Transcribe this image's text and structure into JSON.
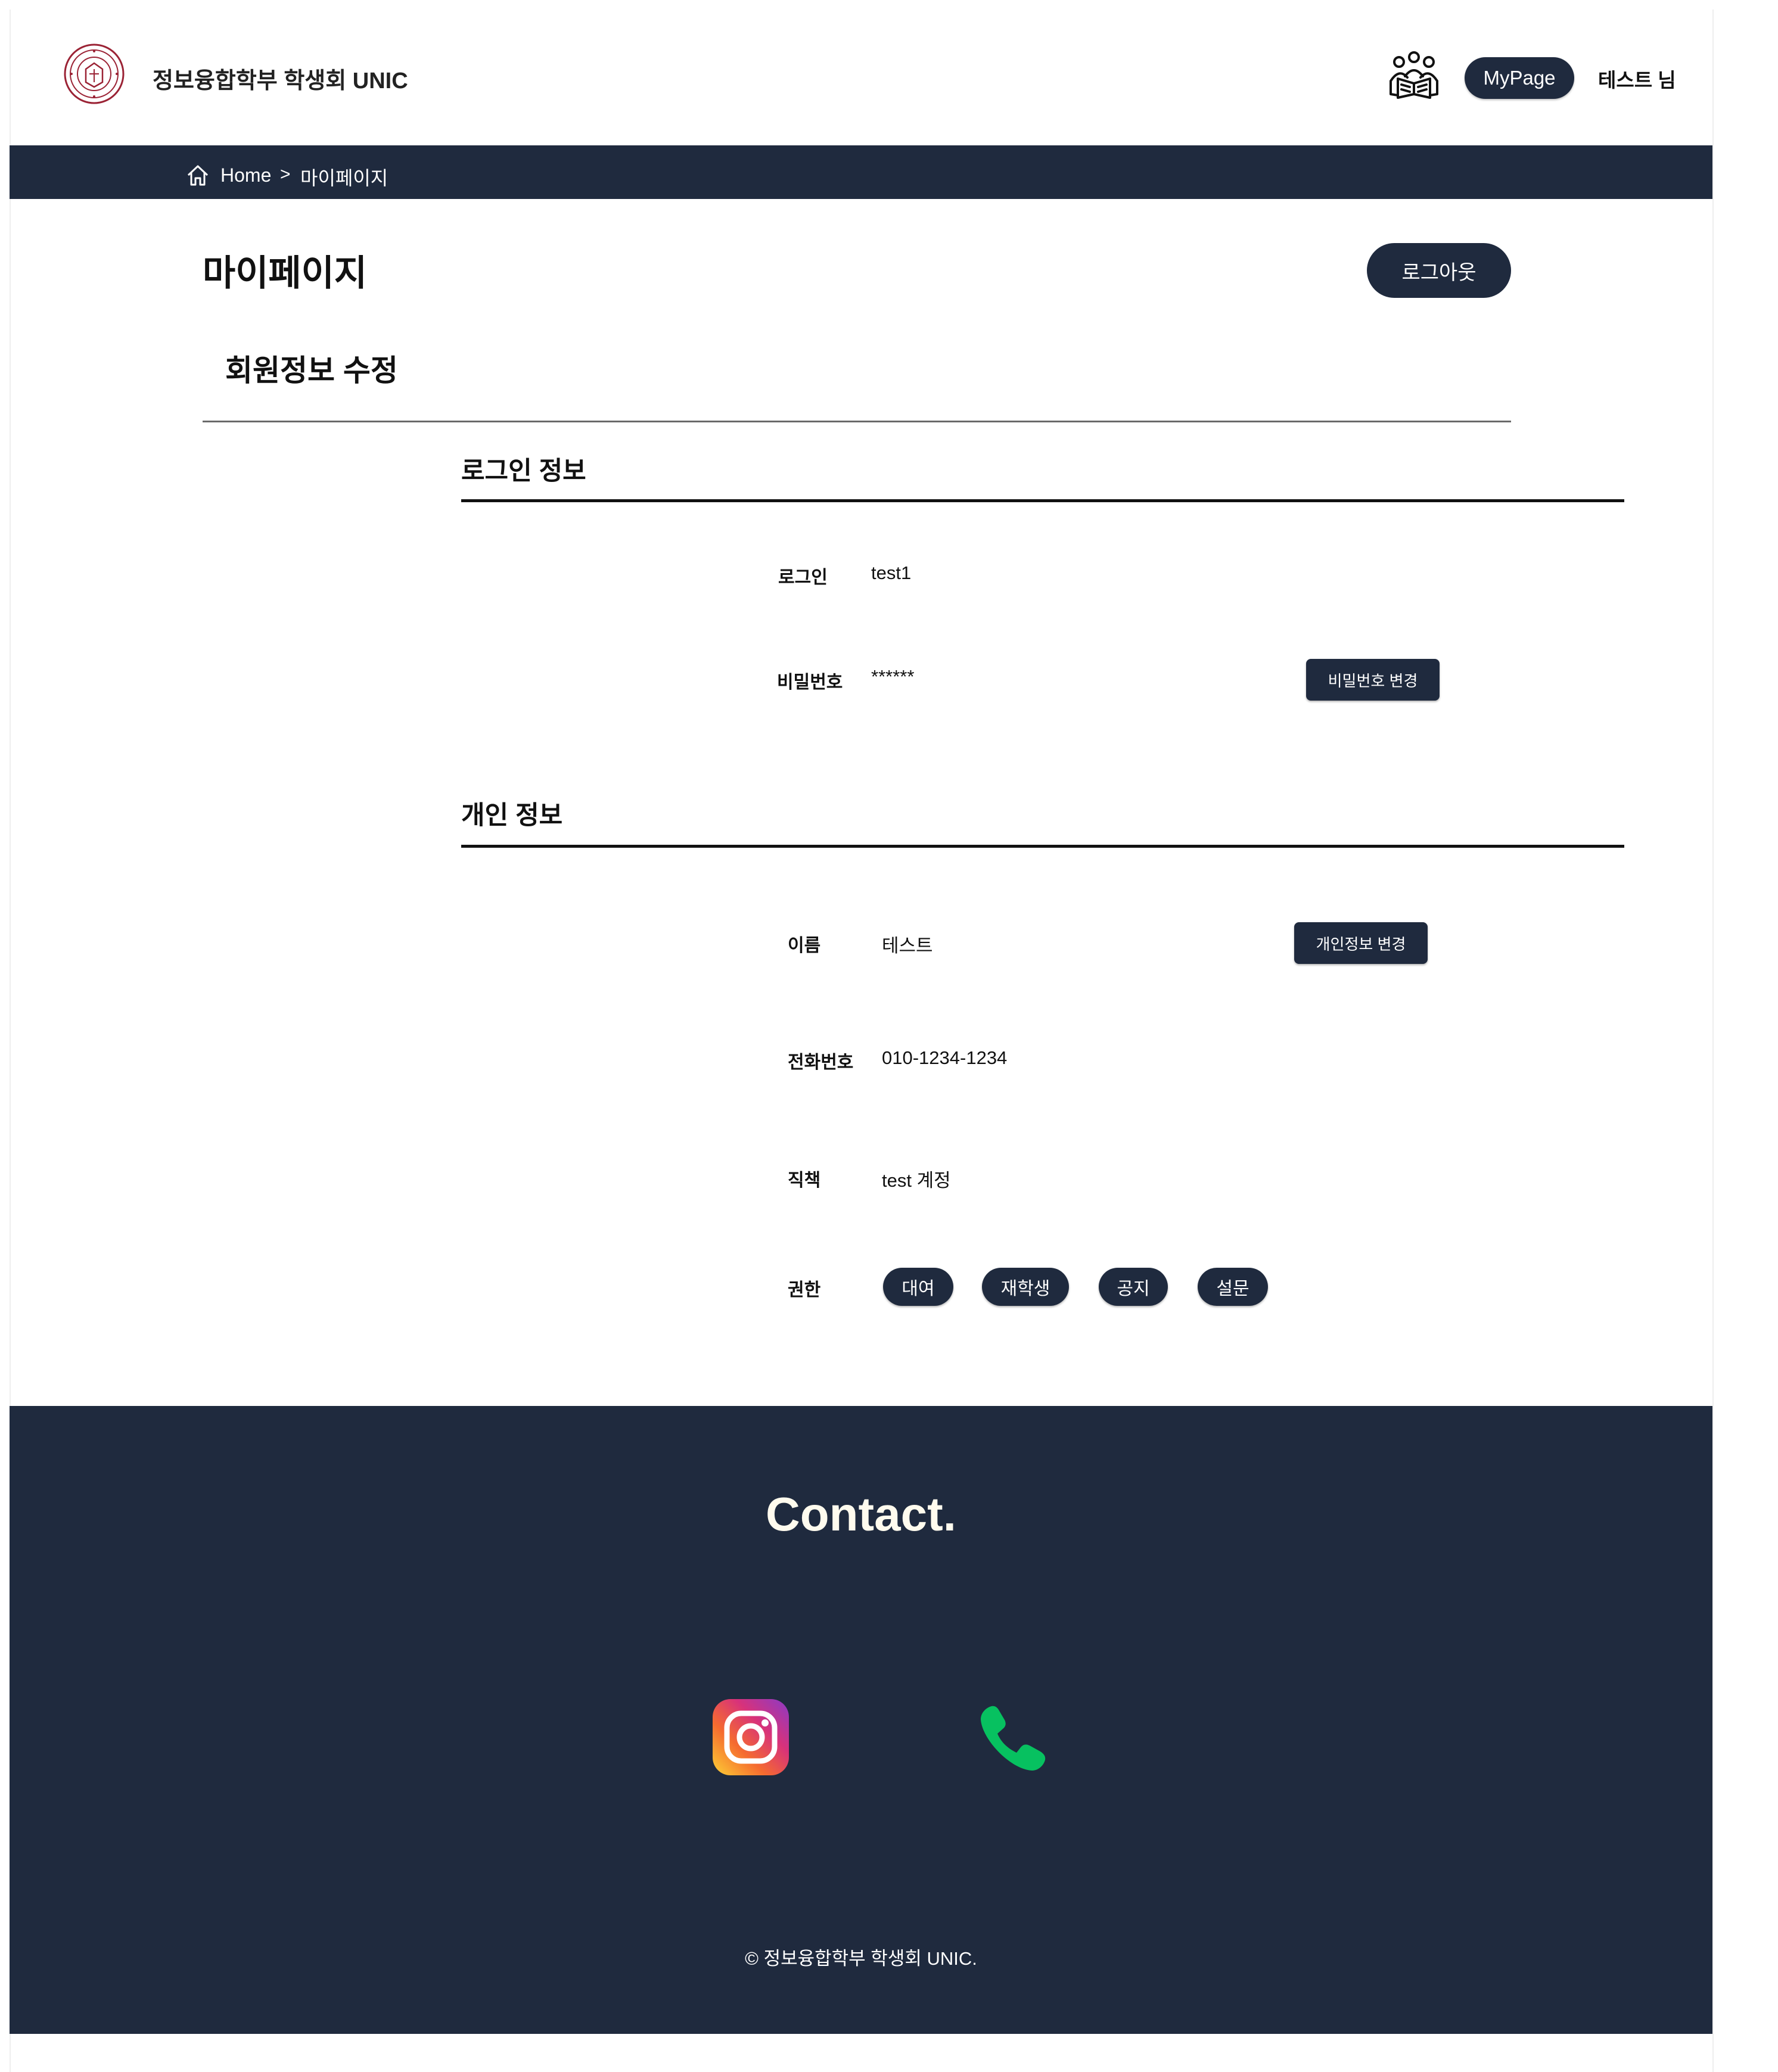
{
  "header": {
    "site_title": "정보융합학부 학생회 UNIC",
    "mypage_label": "MyPage",
    "user_name": "테스트 님"
  },
  "breadcrumb": {
    "home": "Home",
    "separator": ">",
    "current": "마이페이지"
  },
  "page": {
    "title": "마이페이지",
    "logout_label": "로그아웃",
    "section_title": "회원정보 수정"
  },
  "login_info": {
    "title": "로그인 정보",
    "login_label": "로그인",
    "login_value": "test1",
    "password_label": "비밀번호",
    "password_value": "******",
    "change_password_label": "비밀번호 변경"
  },
  "personal_info": {
    "title": "개인 정보",
    "name_label": "이름",
    "name_value": "테스트",
    "change_info_label": "개인정보 변경",
    "phone_label": "전화번호",
    "phone_value": "010-1234-1234",
    "position_label": "직책",
    "position_value": "test 계정",
    "permission_label": "권한",
    "permissions": [
      "대여",
      "재학생",
      "공지",
      "설문"
    ]
  },
  "footer": {
    "contact_title": "Contact.",
    "copyright": "© 정보융합학부 학생회 UNIC."
  },
  "colors": {
    "navy": "#1f2a3e",
    "phone_green": "#07c160",
    "logo_red": "#9b2335"
  },
  "icons": [
    "university-logo",
    "people-reading-icon",
    "home-icon",
    "instagram-icon",
    "phone-icon"
  ]
}
